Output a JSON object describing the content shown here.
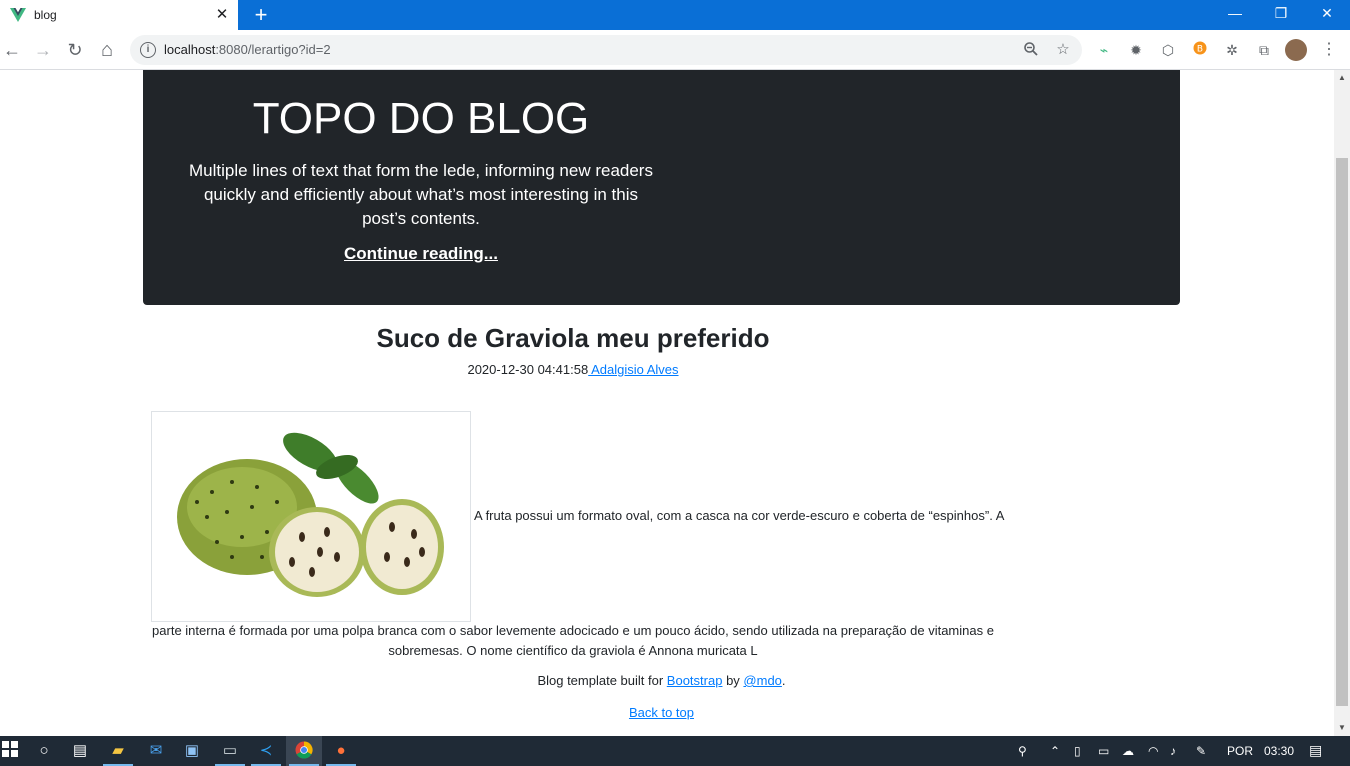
{
  "browser": {
    "tab_title": "blog",
    "tab_close_glyph": "✕",
    "new_tab_glyph": "+",
    "url_host": "localhost",
    "url_path": ":8080/lerartigo?id=2",
    "window_controls": {
      "minimize": "—",
      "restore": "❐",
      "close": "✕"
    },
    "nav": {
      "back": "←",
      "forward": "→",
      "reload": "↻",
      "home": "⌂"
    },
    "extensions": [
      "zoom-icon",
      "star-icon",
      "vue-devtools-icon",
      "gear-extension-icon",
      "cube-extension-icon",
      "bitcoin-extension-icon",
      "bug-extension-icon",
      "puzzle-extensions-icon",
      "profile-avatar",
      "menu-kebab-icon"
    ],
    "accent_color": "#0a6fd6"
  },
  "jumbotron": {
    "title": "TOPO DO BLOG",
    "lead": "Multiple lines of text that form the lede, informing new readers quickly and efficiently about what’s most interesting in this post’s contents.",
    "link": "Continue reading..."
  },
  "post": {
    "title": "Suco de Graviola meu preferido",
    "datetime": "2020-12-30 04:41:58",
    "author": " Adalgisio Alves",
    "text_inline": "A fruta possui um formato oval, com a casca na cor verde-escuro e coberta de “espinhos”. A",
    "text_rest": "parte interna é formada por uma polpa branca com o sabor levemente adocicado e um pouco ácido, sendo utilizada na preparação de vitaminas e sobremesas. O nome científico da graviola é Annona muricata L"
  },
  "footer": {
    "prefix": "Blog template built for ",
    "bootstrap_link": "Bootstrap",
    "by": " by ",
    "mdo_link": "@mdo",
    "suffix": ".",
    "back_to_top": "Back to top"
  },
  "taskbar": {
    "language": "POR",
    "time": "03:30"
  }
}
